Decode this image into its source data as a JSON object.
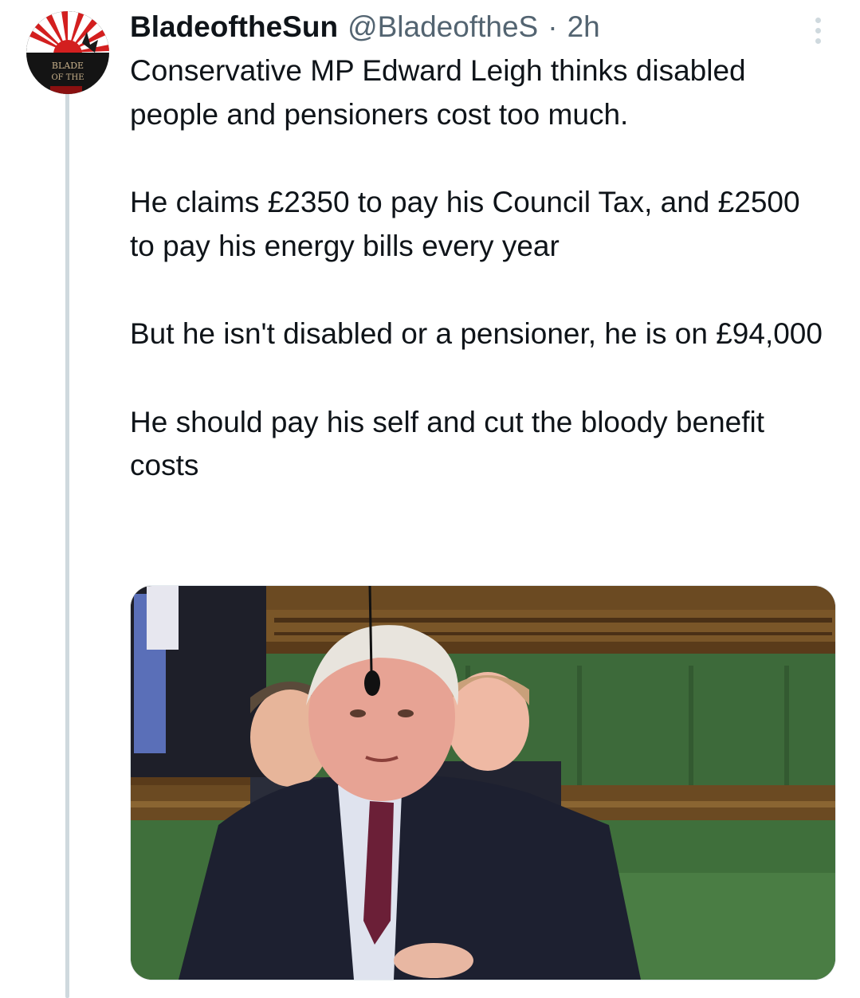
{
  "tweet": {
    "display_name": "BladeoftheSun",
    "handle": "@BladeoftheS",
    "separator": "·",
    "timestamp": "2h",
    "avatar_text": [
      "BLADE",
      "OF THE"
    ],
    "paragraphs": [
      "Conservative MP Edward Leigh thinks disabled people and pensioners cost too much.",
      "He claims £2350 to pay his Council Tax, and £2500 to pay his energy bills every year",
      "But he isn't disabled or a pensioner, he is on £94,000",
      "He should pay his self and cut the bloody benefit costs"
    ]
  },
  "icons": {
    "more": "more-vertical-icon"
  },
  "colors": {
    "text": "#0f1419",
    "secondary": "#536471",
    "thread_line": "#cfd9de",
    "bench_green": "#3d6a3a",
    "wood": "#6b4a22"
  }
}
